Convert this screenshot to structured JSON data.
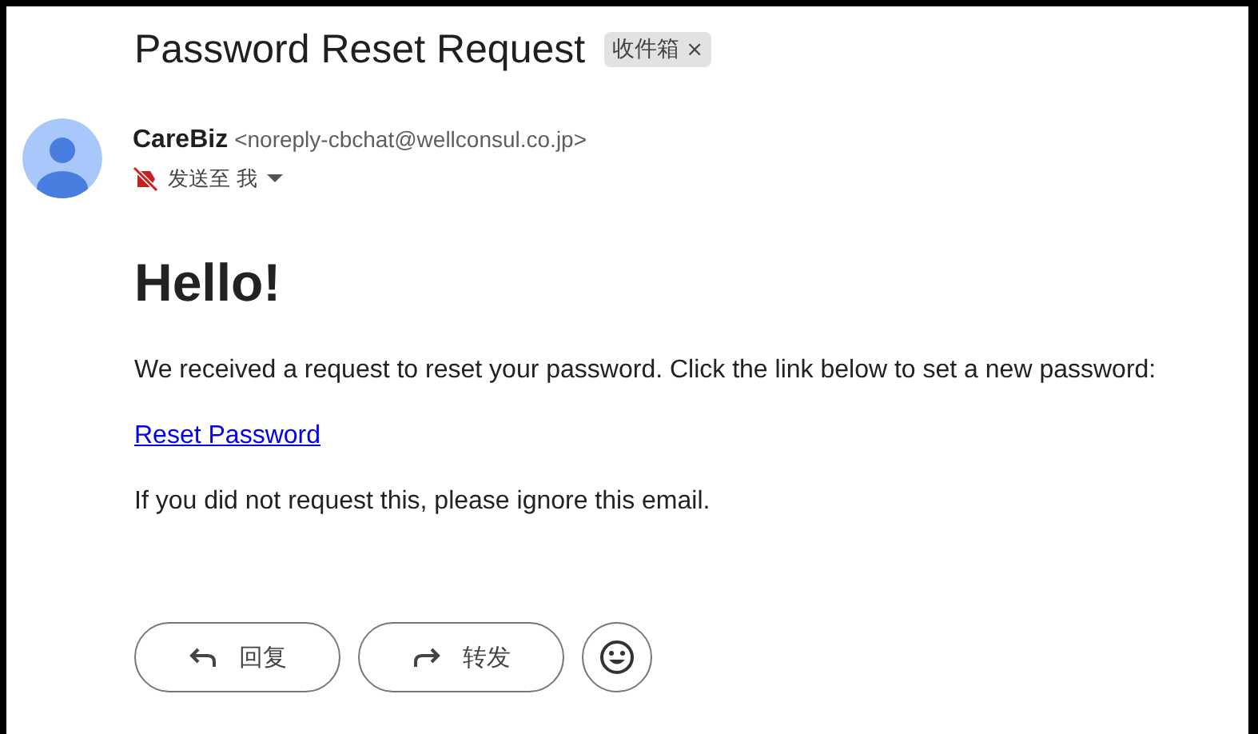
{
  "email": {
    "subject": "Password Reset Request",
    "label": {
      "text": "收件箱",
      "close": "×"
    },
    "sender": {
      "name": "CareBiz",
      "address": "<noreply-cbchat@wellconsul.co.jp>",
      "recipient": "发送至 我"
    },
    "body": {
      "heading": "Hello!",
      "intro": "We received a request to reset your password. Click the link below to set a new password:",
      "link": "Reset Password",
      "footer": "If you did not request this, please ignore this email."
    },
    "actions": [
      {
        "kind": "reply",
        "label": "回复"
      },
      {
        "kind": "forward",
        "label": "转发"
      },
      {
        "kind": "emoji"
      }
    ]
  }
}
